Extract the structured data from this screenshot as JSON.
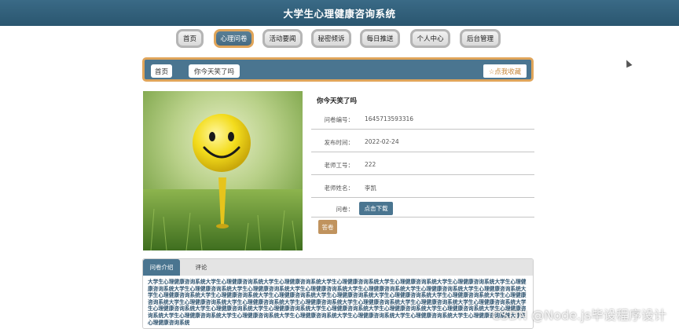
{
  "header": {
    "title": "大学生心理健康咨询系统"
  },
  "nav": {
    "items": [
      {
        "label": "首页",
        "active": false
      },
      {
        "label": "心理问卷",
        "active": true
      },
      {
        "label": "活动要闻",
        "active": false
      },
      {
        "label": "秘密倾诉",
        "active": false
      },
      {
        "label": "每日推送",
        "active": false
      },
      {
        "label": "个人中心",
        "active": false
      },
      {
        "label": "后台管理",
        "active": false
      }
    ]
  },
  "breadcrumb": {
    "home": "首页",
    "current": "你今天笑了吗",
    "favorite": "☆点我收藏"
  },
  "detail": {
    "title": "你今天笑了吗",
    "rows": [
      {
        "label": "问卷编号：",
        "value": "1645713593316"
      },
      {
        "label": "发布时间：",
        "value": "2022-02-24"
      },
      {
        "label": "老师工号：",
        "value": "222"
      },
      {
        "label": "老师姓名：",
        "value": "李凯"
      }
    ],
    "file_label": "问卷：",
    "download_label": "点击下载",
    "answer_label": "答卷"
  },
  "tabs": {
    "items": [
      {
        "label": "问卷介绍",
        "active": true
      },
      {
        "label": "评论",
        "active": false
      }
    ],
    "content": "大学生心理健康咨询系统大学生心理健康咨询系统大学生心理健康咨询系统大学生心理健康咨询系统大学生心理健康咨询系统大学生心理健康咨询系统大学生心理健康咨询系统大学生心理健康咨询系统大学生心理健康咨询系统大学生心理健康咨询系统大学生心理健康咨询系统大学生心理健康咨询系统大学生心理健康咨询系统大学生心理健康咨询系统大学生心理健康咨询系统大学生心理健康咨询系统大学生心理健康咨询系统大学生心理健康咨询系统大学生心理健康咨询系统大学生心理健康咨询系统大学生心理健康咨询系统大学生心理健康咨询系统大学生心理健康咨询系统大学生心理健康咨询系统大学生心理健康咨询系统大学生心理健康咨询系统大学生心理健康咨询系统大学生心理健康咨询系统大学生心理健康咨询系统大学生心理健康咨询系统大学生心理健康咨询系统大学生心理健康咨询系统大学生心理健康咨询系统大学生心理健康咨询系统大学生心理健康咨询系统大学生心理健康咨询系统大学生心理健康咨询系统大学生心理健康咨询系统大学生心理健康咨询系统大学生心理健康咨询系统"
  },
  "watermark": "CSDN @Node.js毕设程序设计",
  "colors": {
    "header": "#2f5d78",
    "accent": "#4a7590",
    "active_border": "#e0a55a",
    "answer": "#c0935e"
  }
}
